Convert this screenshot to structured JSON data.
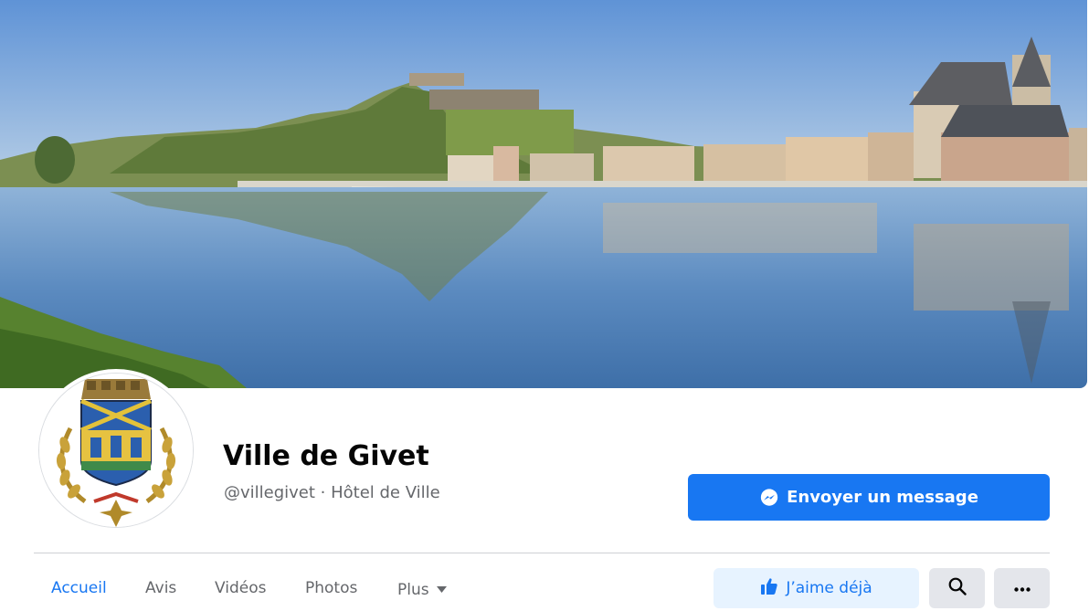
{
  "page": {
    "name": "Ville de Givet",
    "handle_category": "@villegivet · Hôtel de Ville"
  },
  "actions": {
    "message_label": "Envoyer un message",
    "like_label": "J’aime déjà"
  },
  "tabs": [
    {
      "label": "Accueil",
      "active": true
    },
    {
      "label": "Avis",
      "active": false
    },
    {
      "label": "Vidéos",
      "active": false
    },
    {
      "label": "Photos",
      "active": false
    },
    {
      "label": "Plus",
      "active": false
    }
  ],
  "icons": {
    "messenger": "messenger-icon",
    "like": "thumbs-up-icon",
    "search": "search-icon",
    "more": "more-horizontal-icon",
    "dropdown": "caret-down-icon"
  },
  "colors": {
    "accent": "#1877f2",
    "accent_light": "#e7f3ff",
    "secondary_button": "#e4e6eb",
    "text_primary": "#050505",
    "text_secondary": "#65676b"
  }
}
